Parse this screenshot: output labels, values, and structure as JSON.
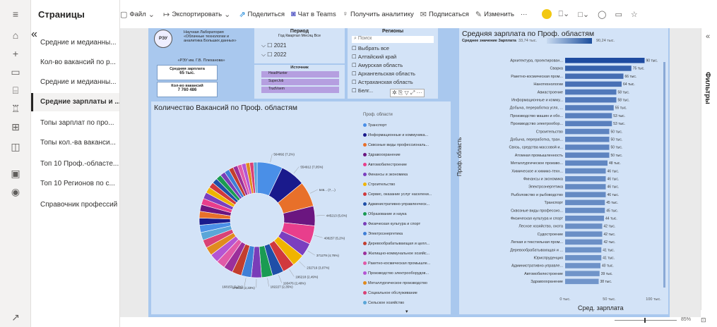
{
  "pages_panel": {
    "title": "Страницы",
    "collapse_glyph": "«",
    "items": [
      {
        "label": "Средние и медианны..."
      },
      {
        "label": "Кол-во вакансий по р..."
      },
      {
        "label": "Средние и медианны..."
      },
      {
        "label": "Средние зарплаты и ..."
      },
      {
        "label": "Топы зарплат по про..."
      },
      {
        "label": "Топы кол.-ва ваканси..."
      },
      {
        "label": "Топ 10 Проф.-областе..."
      },
      {
        "label": "Топ 10 Регионов по с..."
      },
      {
        "label": "Справочник профессий"
      }
    ],
    "active_index": 3
  },
  "toolbar": {
    "file": "Файл",
    "export": "Экспортировать",
    "share": "Поделиться",
    "teams": "Чат в Teams",
    "insights": "Получить аналитику",
    "subscribe": "Подписаться",
    "edit": "Изменить",
    "more": "···"
  },
  "filters_pane": {
    "label": "Фильтры"
  },
  "status": {
    "zoom": "85%"
  },
  "report": {
    "logo_text": "РЭУ",
    "lab_name": [
      "Научная Лаборатория",
      "«Облачные технологии и",
      "аналитика Больших данных»"
    ],
    "lab_org": "«РЭУ им. Г.В. Плеханова»",
    "avg_salary_label": "Средняя зарплата",
    "avg_salary_value": "65 тыс.",
    "vacancies_label": "Кол-во вакансий",
    "vacancies_value": "7 760 486",
    "period": {
      "title": "Период",
      "subtitle": "Год Квартал Месяц Все",
      "items": [
        "2021",
        "2022"
      ]
    },
    "source": {
      "title": "Источник",
      "items": [
        "HeadHunter",
        "SuperJob",
        "TrudVsem"
      ]
    },
    "regions": {
      "title": "Регионы",
      "search_placeholder": "Поиск",
      "items": [
        "Выбрать все",
        "Алтайский край",
        "Амурская область",
        "Архангельская область",
        "Астраханская область",
        "Белг..."
      ]
    },
    "donut": {
      "title": "Количество Вакансий по Проф. областям",
      "legend_title": "Проф. области"
    },
    "bars": {
      "title": "Средняя зарплата по Проф. областям",
      "gradient_label": "Среднее значение Зарплата",
      "gradient_min": "33,74 тыс.",
      "gradient_max": "90,24 тыс.",
      "ylabel": "Проф. область",
      "xlabel": "Сред. зарплата",
      "xticks": [
        "0 тыс.",
        "50 тыс.",
        "100 тыс."
      ]
    }
  },
  "chart_data": [
    {
      "type": "pie",
      "title": "Количество Вакансий по Проф. областям",
      "legend": [
        "Транспорт",
        "Информационные и коммуника...",
        "Сквозные виды профессиональ...",
        "Здравоохранение",
        "Автомобилестроение",
        "Финансы и экономика",
        "Строительство",
        "Сервис, оказание услуг населени...",
        "Административно-управленческ...",
        "Образование и наука",
        "Физическая культура и спорт",
        "Электроэнергетика",
        "Деревообрабатывающая и целл...",
        "Жилищно-коммунальное хозяйс...",
        "Ракетно-космическая промышле...",
        "Производство электрооборудов...",
        "Металлургическое производство",
        "Социальное обслуживание",
        "Сельское хозяйство"
      ],
      "colors": [
        "#4a8fe7",
        "#1a1a8c",
        "#e8702a",
        "#6b1680",
        "#e83e8c",
        "#7b3fbf",
        "#f0b400",
        "#d1393d",
        "#1f4fa8",
        "#1a9b52",
        "#7a3db8",
        "#3f7fd6",
        "#c33e2e",
        "#9b2f9b",
        "#e15aa8",
        "#b455d3",
        "#e08b1e",
        "#d94276",
        "#5aa6d8"
      ],
      "values": [
        7.2,
        7.0,
        7.1,
        5.6,
        5.2,
        3.9,
        3.5,
        3.4,
        3.2,
        3.1,
        2.9,
        2.8,
        2.7,
        2.6,
        2.5,
        2.5,
        2.4,
        2.3,
        2.2,
        2.1,
        2.0,
        1.9,
        1.9,
        1.8,
        1.8,
        1.7,
        1.6,
        1.5,
        1.5,
        1.4,
        1.4,
        1.3,
        1.3,
        1.2,
        1.2,
        1.1,
        1.1,
        1.0
      ],
      "slice_labels": [
        "564892 (7,2%)",
        "554912 (7,05%)",
        "546... (7,...)",
        "445213 (5,6%)",
        "408257 (5,2%)",
        "371279 (4,76%)",
        "232716 (3,07%)",
        "196218 (2,49%)",
        "193476 (2,48%)",
        "182227 (2,35%)",
        "179612 (2,33%)",
        "168153 (2,2%)",
        "",
        "",
        "",
        "",
        "",
        "",
        "",
        "",
        "",
        "",
        "",
        "",
        "",
        "",
        "",
        "",
        "",
        "",
        "",
        "",
        "",
        "",
        "",
        "",
        "",
        ""
      ]
    },
    {
      "type": "bar",
      "orientation": "horizontal",
      "title": "Средняя зарплата по Проф. областям",
      "ylabel": "Проф. область",
      "xlabel": "Сред. зарплата",
      "xlim": [
        0,
        100
      ],
      "categories": [
        "Архитектура, проектирован...",
        "Сварка",
        "Ракетно-космическая пром...",
        "Нанотехнологии",
        "Авиастроение",
        "Информационные и комму...",
        "Добыча, переработка угля, ...",
        "Производство машин и обо...",
        "Производство электрообор...",
        "Строительство",
        "Добыча, переработка, тран...",
        "Связь, средства массовой и...",
        "Атомная промышленность",
        "Металлургическое произво...",
        "Химическое и химико-техн...",
        "Финансы и экономика",
        "Электроэнергетика",
        "Рыболовство и рыбоводство",
        "Транспорт",
        "Сквозные виды профессио...",
        "Физическая культура и спорт",
        "Лесное хозяйство, охота",
        "Судостроение",
        "Легкая и текстильная пром...",
        "Деревообрабатывающая и ...",
        "Юриспруденция",
        "Административно-управле...",
        "Автомобилестроение",
        "Здравоохранение"
      ],
      "values": [
        90,
        75,
        66,
        64,
        58,
        58,
        55,
        53,
        53,
        50,
        50,
        50,
        50,
        48,
        46,
        46,
        46,
        46,
        45,
        45,
        44,
        42,
        42,
        42,
        41,
        41,
        40,
        39,
        38
      ],
      "value_labels": [
        "90 тыс.",
        "75 тыс.",
        "66 тыс.",
        "64 тыс.",
        "58 тыс.",
        "58 тыс.",
        "55 тыс.",
        "53 тыс.",
        "53 тыс.",
        "50 тыс.",
        "50 тыс.",
        "50 тыс.",
        "50 тыс.",
        "48 тыс.",
        "46 тыс.",
        "46 тыс.",
        "46 тыс.",
        "46 тыс.",
        "45 тыс.",
        "45 тыс.",
        "44 тыс.",
        "42 тыс.",
        "42 тыс.",
        "42 тыс.",
        "41 тыс.",
        "41 тыс.",
        "40 тыс.",
        "39 тыс.",
        "38 тыс."
      ]
    }
  ]
}
